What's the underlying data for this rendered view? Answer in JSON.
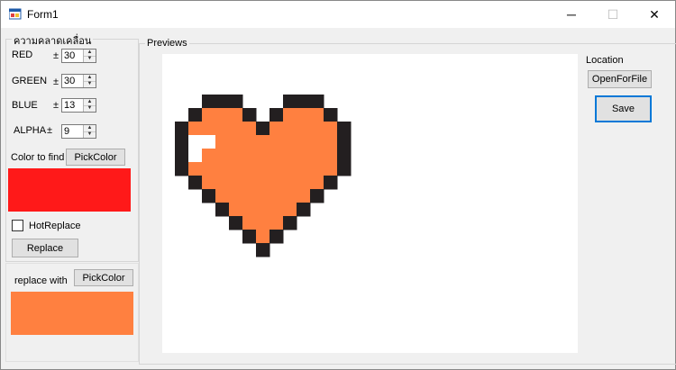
{
  "window": {
    "title": "Form1",
    "minimize_glyph": "─",
    "maximize_glyph": "☐",
    "close_glyph": "✕"
  },
  "tolerance_group": {
    "title": "ความคลาดเคลื่อน",
    "rows": [
      {
        "label": "RED",
        "pm": "±",
        "value": "30"
      },
      {
        "label": "GREEN",
        "pm": "±",
        "value": "30"
      },
      {
        "label": "BLUE",
        "pm": "±",
        "value": "13"
      },
      {
        "label": "ALPHA",
        "pm": "±",
        "value": "9"
      }
    ],
    "color_to_find_label": "Color to find",
    "pick_color_label": "PickColor",
    "find_color": "#ff1919",
    "hot_replace_label": "HotReplace",
    "hot_replace_checked": false,
    "replace_label": "Replace"
  },
  "replace_section": {
    "replace_with_label": "replace with",
    "pick_color_label": "PickColor",
    "replace_color": "#ff8040"
  },
  "previews": {
    "title": "Previews",
    "image": {
      "heart_fill": "#ff8040",
      "outline": "#231f20",
      "highlight": "#ffffff"
    }
  },
  "location": {
    "label": "Location",
    "open_label": "OpenForFile",
    "save_label": "Save"
  }
}
